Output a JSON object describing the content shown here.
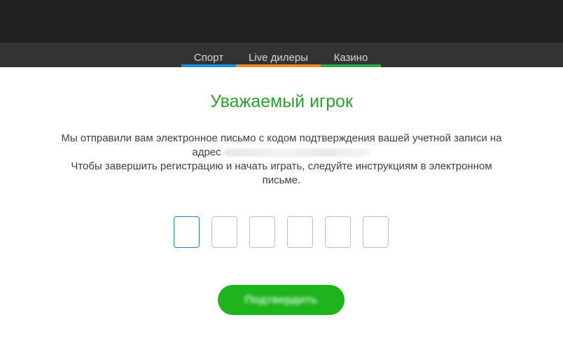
{
  "header": {
    "tabs": [
      {
        "label": "Спорт",
        "color": "#1f8fd8"
      },
      {
        "label": "Live дилеры",
        "color": "#f08a2c"
      },
      {
        "label": "Казино",
        "color": "#2aa84a"
      }
    ]
  },
  "main": {
    "title": "Уважаемый игрок",
    "title_color": "#2aa12a",
    "message_line1": "Мы отправили вам электронное письмо с кодом подтверждения вашей учетной записи на адрес",
    "message_line2": "Чтобы завершить регистрацию и начать играть, следуйте инструкциям в электронном письме.",
    "code_digits": [
      "",
      "",
      "",
      "",
      "",
      ""
    ],
    "confirm_label": "Подтвердить",
    "confirm_color": "#1db31d"
  }
}
